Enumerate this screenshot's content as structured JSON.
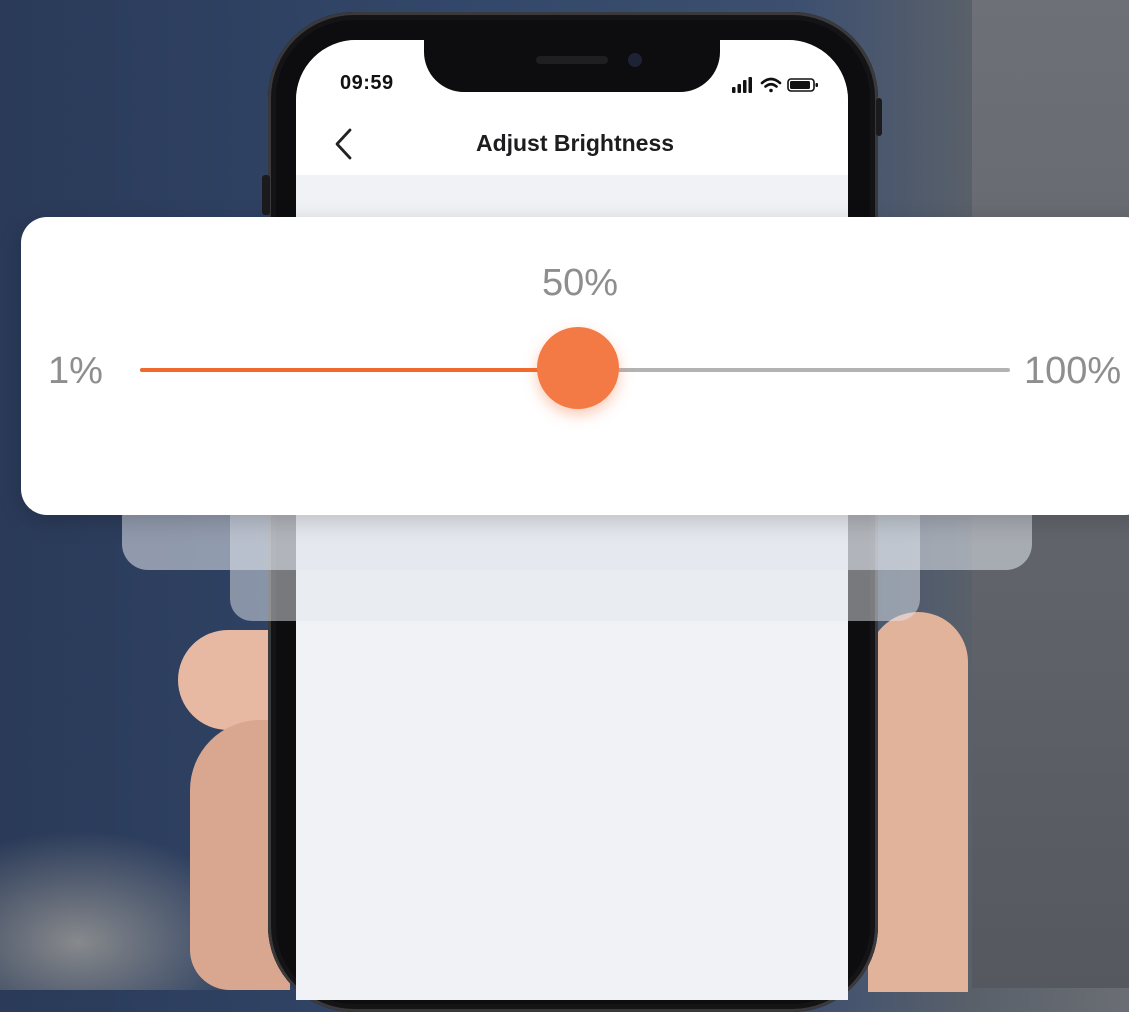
{
  "status_bar": {
    "time": "09:59",
    "icons": [
      "signal-icon",
      "wifi-icon",
      "battery-icon"
    ]
  },
  "nav": {
    "back_icon": "chevron-left-icon",
    "title": "Adjust Brightness"
  },
  "brightness": {
    "value_label": "50%",
    "min_label": "1%",
    "max_label": "100%",
    "value_fraction": 0.5
  },
  "colors": {
    "accent": "#f06a2e",
    "thumb": "#f47a45",
    "track_inactive": "#b3b3b3",
    "label_gray": "#8e8e8e"
  }
}
